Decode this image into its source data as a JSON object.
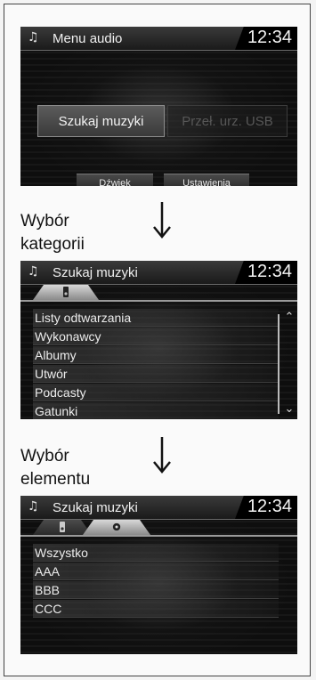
{
  "screen1": {
    "title": "Menu audio",
    "clock": "12:34",
    "buttons": {
      "search": "Szukaj muzyki",
      "usb": "Przeł. urz. USB"
    },
    "soft_buttons": {
      "sound": "Dźwięk",
      "settings": "Ustawienia"
    }
  },
  "step1": {
    "line1": "Wybór",
    "line2": "kategorii"
  },
  "screen2": {
    "title": "Szukaj muzyki",
    "clock": "12:34",
    "items": [
      "Listy odtwarzania",
      "Wykonawcy",
      "Albumy",
      "Utwór",
      "Podcasty",
      "Gatunki"
    ]
  },
  "step2": {
    "line1": "Wybór",
    "line2": "elementu"
  },
  "screen3": {
    "title": "Szukaj muzyki",
    "clock": "12:34",
    "items": [
      "Wszystko",
      "AAA",
      "BBB",
      "CCC"
    ]
  },
  "icons": {
    "note": "music-note-icon",
    "ipod": "ipod-icon",
    "disc": "disc-icon",
    "arrow": "down-arrow-icon",
    "scroll_up": "double-chevron-up-icon",
    "scroll_down": "double-chevron-down-icon"
  }
}
